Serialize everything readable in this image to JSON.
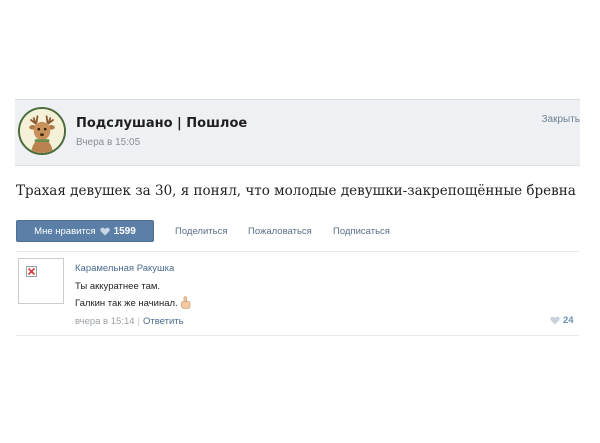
{
  "post": {
    "group_name": "Подслушано | Пошлое",
    "time": "Вчера в 15:05",
    "close_label": "Закрыть",
    "text": "Трахая девушек за 30, я понял, что молодые девушки-закрепощённые бревна"
  },
  "actions": {
    "like_label": "Мне нравится",
    "like_count": "1599",
    "share_label": "Поделиться",
    "report_label": "Пожаловаться",
    "subscribe_label": "Подписаться"
  },
  "comment": {
    "author": "Карамельная Ракушка",
    "lines": [
      "Ты аккуратнее там.",
      "Галкин так же начинал."
    ],
    "time": "вчера в 15:14",
    "reply_label": "Ответить",
    "likes": "24"
  },
  "icons": {
    "avatar": "deer-avatar-icon",
    "like": "heart-icon",
    "broken_image": "broken-image-icon",
    "emoji": "pointing-up-emoji-icon"
  },
  "colors": {
    "accent": "#5b7fa6",
    "link": "#4b6b8f",
    "header_bg": "#eef0f3"
  }
}
